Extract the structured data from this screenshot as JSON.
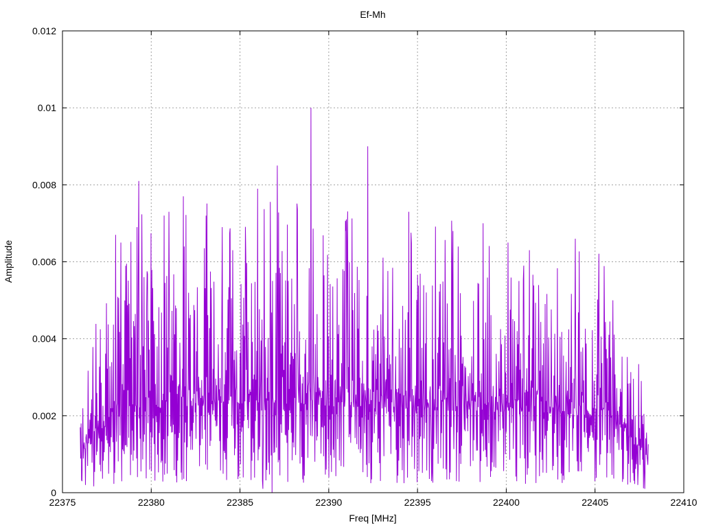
{
  "chart_data": {
    "type": "line",
    "title": "Ef-Mh",
    "xlabel": "Freq [MHz]",
    "ylabel": "Amplitude",
    "xlim": [
      22375,
      22410
    ],
    "ylim": [
      0,
      0.012
    ],
    "x_ticks": [
      22375,
      22380,
      22385,
      22390,
      22395,
      22400,
      22405,
      22410
    ],
    "x_tick_labels": [
      "22375",
      "22380",
      "22385",
      "22390",
      "22395",
      "22400",
      "22405",
      "22410"
    ],
    "y_ticks": [
      0,
      0.002,
      0.004,
      0.006,
      0.008,
      0.01,
      0.012
    ],
    "y_tick_labels": [
      "0",
      "0.002",
      "0.004",
      "0.006",
      "0.008",
      "0.01",
      "0.012"
    ],
    "grid": true,
    "legend": "none",
    "series": [
      {
        "color": "#9400d3",
        "x_start": 22376.0,
        "x_end": 22408.0,
        "envelope_x": [
          22376.0,
          22377.5,
          22379.0,
          22382.0,
          22386.0,
          22390.0,
          22394.0,
          22398.0,
          22402.0,
          22405.0,
          22406.5,
          22408.0
        ],
        "envelope_y": [
          0.0022,
          0.004,
          0.0048,
          0.005,
          0.0052,
          0.005,
          0.0048,
          0.0047,
          0.0046,
          0.0044,
          0.0034,
          0.0016
        ],
        "peaks": [
          {
            "x": 22378.0,
            "y": 0.0067
          },
          {
            "x": 22378.3,
            "y": 0.0065
          },
          {
            "x": 22379.3,
            "y": 0.0081
          },
          {
            "x": 22379.2,
            "y": 0.0069
          },
          {
            "x": 22381.0,
            "y": 0.0073
          },
          {
            "x": 22381.8,
            "y": 0.0077
          },
          {
            "x": 22383.1,
            "y": 0.0072
          },
          {
            "x": 22384.0,
            "y": 0.0069
          },
          {
            "x": 22386.0,
            "y": 0.0079
          },
          {
            "x": 22386.3,
            "y": 0.0077
          },
          {
            "x": 22387.1,
            "y": 0.0085
          },
          {
            "x": 22389.0,
            "y": 0.01
          },
          {
            "x": 22391.0,
            "y": 0.0071
          },
          {
            "x": 22392.2,
            "y": 0.009
          },
          {
            "x": 22394.5,
            "y": 0.0073
          },
          {
            "x": 22397.0,
            "y": 0.0068
          },
          {
            "x": 22398.7,
            "y": 0.007
          },
          {
            "x": 22400.1,
            "y": 0.0065
          },
          {
            "x": 22401.3,
            "y": 0.0063
          },
          {
            "x": 22403.9,
            "y": 0.0066
          },
          {
            "x": 22405.0,
            "y": 0.0058
          },
          {
            "x": 22406.0,
            "y": 0.005
          }
        ],
        "dips": [
          {
            "x": 22376.1,
            "y": 0.0003
          },
          {
            "x": 22376.3,
            "y": 0.0002
          },
          {
            "x": 22386.3,
            "y": 0.0001
          },
          {
            "x": 22386.8,
            "y": 0.0
          },
          {
            "x": 22390.0,
            "y": 0.0004
          },
          {
            "x": 22395.8,
            "y": 0.0003
          },
          {
            "x": 22397.2,
            "y": 0.0003
          },
          {
            "x": 22405.0,
            "y": 0.0003
          },
          {
            "x": 22407.4,
            "y": 0.0002
          },
          {
            "x": 22407.8,
            "y": 0.0001
          }
        ]
      }
    ]
  }
}
